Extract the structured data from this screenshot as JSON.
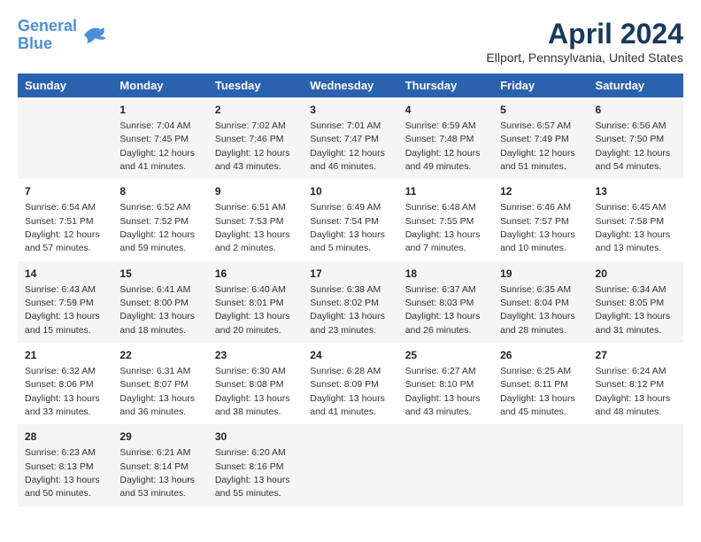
{
  "header": {
    "logo_line1": "General",
    "logo_line2": "Blue",
    "main_title": "April 2024",
    "subtitle": "Ellport, Pennsylvania, United States"
  },
  "calendar": {
    "columns": [
      "Sunday",
      "Monday",
      "Tuesday",
      "Wednesday",
      "Thursday",
      "Friday",
      "Saturday"
    ],
    "weeks": [
      [
        {
          "day": "",
          "info": ""
        },
        {
          "day": "1",
          "info": "Sunrise: 7:04 AM\nSunset: 7:45 PM\nDaylight: 12 hours\nand 41 minutes."
        },
        {
          "day": "2",
          "info": "Sunrise: 7:02 AM\nSunset: 7:46 PM\nDaylight: 12 hours\nand 43 minutes."
        },
        {
          "day": "3",
          "info": "Sunrise: 7:01 AM\nSunset: 7:47 PM\nDaylight: 12 hours\nand 46 minutes."
        },
        {
          "day": "4",
          "info": "Sunrise: 6:59 AM\nSunset: 7:48 PM\nDaylight: 12 hours\nand 49 minutes."
        },
        {
          "day": "5",
          "info": "Sunrise: 6:57 AM\nSunset: 7:49 PM\nDaylight: 12 hours\nand 51 minutes."
        },
        {
          "day": "6",
          "info": "Sunrise: 6:56 AM\nSunset: 7:50 PM\nDaylight: 12 hours\nand 54 minutes."
        }
      ],
      [
        {
          "day": "7",
          "info": "Sunrise: 6:54 AM\nSunset: 7:51 PM\nDaylight: 12 hours\nand 57 minutes."
        },
        {
          "day": "8",
          "info": "Sunrise: 6:52 AM\nSunset: 7:52 PM\nDaylight: 12 hours\nand 59 minutes."
        },
        {
          "day": "9",
          "info": "Sunrise: 6:51 AM\nSunset: 7:53 PM\nDaylight: 13 hours\nand 2 minutes."
        },
        {
          "day": "10",
          "info": "Sunrise: 6:49 AM\nSunset: 7:54 PM\nDaylight: 13 hours\nand 5 minutes."
        },
        {
          "day": "11",
          "info": "Sunrise: 6:48 AM\nSunset: 7:55 PM\nDaylight: 13 hours\nand 7 minutes."
        },
        {
          "day": "12",
          "info": "Sunrise: 6:46 AM\nSunset: 7:57 PM\nDaylight: 13 hours\nand 10 minutes."
        },
        {
          "day": "13",
          "info": "Sunrise: 6:45 AM\nSunset: 7:58 PM\nDaylight: 13 hours\nand 13 minutes."
        }
      ],
      [
        {
          "day": "14",
          "info": "Sunrise: 6:43 AM\nSunset: 7:59 PM\nDaylight: 13 hours\nand 15 minutes."
        },
        {
          "day": "15",
          "info": "Sunrise: 6:41 AM\nSunset: 8:00 PM\nDaylight: 13 hours\nand 18 minutes."
        },
        {
          "day": "16",
          "info": "Sunrise: 6:40 AM\nSunset: 8:01 PM\nDaylight: 13 hours\nand 20 minutes."
        },
        {
          "day": "17",
          "info": "Sunrise: 6:38 AM\nSunset: 8:02 PM\nDaylight: 13 hours\nand 23 minutes."
        },
        {
          "day": "18",
          "info": "Sunrise: 6:37 AM\nSunset: 8:03 PM\nDaylight: 13 hours\nand 26 minutes."
        },
        {
          "day": "19",
          "info": "Sunrise: 6:35 AM\nSunset: 8:04 PM\nDaylight: 13 hours\nand 28 minutes."
        },
        {
          "day": "20",
          "info": "Sunrise: 6:34 AM\nSunset: 8:05 PM\nDaylight: 13 hours\nand 31 minutes."
        }
      ],
      [
        {
          "day": "21",
          "info": "Sunrise: 6:32 AM\nSunset: 8:06 PM\nDaylight: 13 hours\nand 33 minutes."
        },
        {
          "day": "22",
          "info": "Sunrise: 6:31 AM\nSunset: 8:07 PM\nDaylight: 13 hours\nand 36 minutes."
        },
        {
          "day": "23",
          "info": "Sunrise: 6:30 AM\nSunset: 8:08 PM\nDaylight: 13 hours\nand 38 minutes."
        },
        {
          "day": "24",
          "info": "Sunrise: 6:28 AM\nSunset: 8:09 PM\nDaylight: 13 hours\nand 41 minutes."
        },
        {
          "day": "25",
          "info": "Sunrise: 6:27 AM\nSunset: 8:10 PM\nDaylight: 13 hours\nand 43 minutes."
        },
        {
          "day": "26",
          "info": "Sunrise: 6:25 AM\nSunset: 8:11 PM\nDaylight: 13 hours\nand 45 minutes."
        },
        {
          "day": "27",
          "info": "Sunrise: 6:24 AM\nSunset: 8:12 PM\nDaylight: 13 hours\nand 48 minutes."
        }
      ],
      [
        {
          "day": "28",
          "info": "Sunrise: 6:23 AM\nSunset: 8:13 PM\nDaylight: 13 hours\nand 50 minutes."
        },
        {
          "day": "29",
          "info": "Sunrise: 6:21 AM\nSunset: 8:14 PM\nDaylight: 13 hours\nand 53 minutes."
        },
        {
          "day": "30",
          "info": "Sunrise: 6:20 AM\nSunset: 8:16 PM\nDaylight: 13 hours\nand 55 minutes."
        },
        {
          "day": "",
          "info": ""
        },
        {
          "day": "",
          "info": ""
        },
        {
          "day": "",
          "info": ""
        },
        {
          "day": "",
          "info": ""
        }
      ]
    ]
  }
}
